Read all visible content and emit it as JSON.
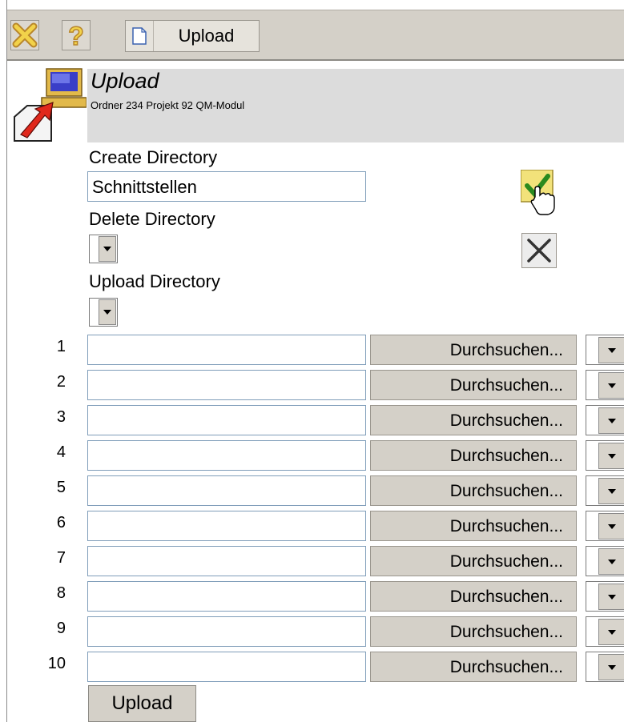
{
  "toolbar": {
    "upload_label": "Upload"
  },
  "header": {
    "title": "Upload",
    "subtitle": "Ordner 234 Projekt 92 QM-Modul"
  },
  "create_directory": {
    "label": "Create Directory",
    "value": "Schnittstellen"
  },
  "delete_directory": {
    "label": "Delete Directory"
  },
  "upload_directory": {
    "label": "Upload Directory"
  },
  "files": [
    {
      "num": "1",
      "browse_label": "Durchsuchen..."
    },
    {
      "num": "2",
      "browse_label": "Durchsuchen..."
    },
    {
      "num": "3",
      "browse_label": "Durchsuchen..."
    },
    {
      "num": "4",
      "browse_label": "Durchsuchen..."
    },
    {
      "num": "5",
      "browse_label": "Durchsuchen..."
    },
    {
      "num": "6",
      "browse_label": "Durchsuchen..."
    },
    {
      "num": "7",
      "browse_label": "Durchsuchen..."
    },
    {
      "num": "8",
      "browse_label": "Durchsuchen..."
    },
    {
      "num": "9",
      "browse_label": "Durchsuchen..."
    },
    {
      "num": "10",
      "browse_label": "Durchsuchen..."
    }
  ],
  "submit_label": "Upload",
  "icons": {
    "close": "close-icon",
    "help": "help-icon",
    "document": "document-icon",
    "computer_upload": "computer-upload-icon",
    "confirm": "checkmark-icon",
    "delete": "delete-x-icon"
  },
  "colors": {
    "toolbar_bg": "#d4d0c8",
    "header_bg": "#dcdcdc",
    "accent_yellow": "#f2d24a"
  }
}
